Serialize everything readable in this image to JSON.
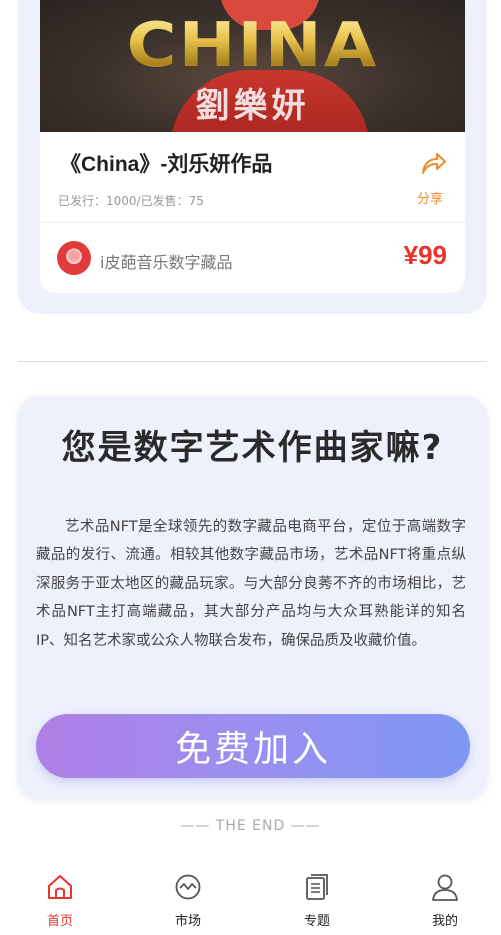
{
  "product": {
    "image_title": "CHINA",
    "image_subtitle": "劉樂妍",
    "title": "《China》-刘乐妍作品",
    "meta": "已发行：1000/已发售：75",
    "share_label": "分享",
    "creator_name": "i皮葩音乐数字藏品",
    "price": "¥99"
  },
  "promo": {
    "heading": "您是数字艺术作曲家嘛?",
    "body": "艺术品NFT是全球领先的数字藏品电商平台，定位于高端数字藏品的发行、流通。相较其他数字藏品市场，艺术品NFT将重点纵深服务于亚太地区的藏品玩家。与大部分良莠不齐的市场相比，艺术品NFT主打高端藏品，其大部分产品均与大众耳熟能详的知名IP、知名艺术家或公众人物联合发布，确保品质及收藏价值。",
    "button_label": "免费加入"
  },
  "footer_text": "—— THE END ——",
  "tabs": [
    {
      "label": "首页",
      "icon": "home-icon",
      "active": true
    },
    {
      "label": "市场",
      "icon": "market-icon",
      "active": false
    },
    {
      "label": "专题",
      "icon": "topics-icon",
      "active": false
    },
    {
      "label": "我的",
      "icon": "profile-icon",
      "active": false
    }
  ],
  "colors": {
    "accent_red": "#e8342c",
    "share_orange": "#f08a2c",
    "button_gradient_start": "#b07fe6",
    "button_gradient_end": "#7d97f2",
    "card_bg": "#eef1fc"
  }
}
